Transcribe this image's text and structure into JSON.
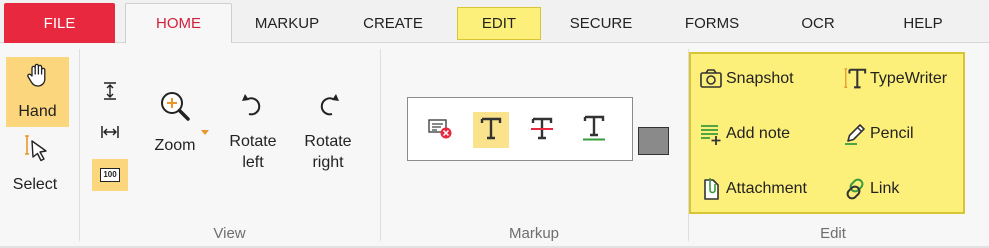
{
  "tabs": {
    "file": "FILE",
    "home": "HOME",
    "markup": "MARKUP",
    "create": "CREATE",
    "edit": "EDIT",
    "secure": "SECURE",
    "forms": "FORMS",
    "ocr": "OCR",
    "help": "HELP"
  },
  "view_group": {
    "hand_label": "Hand",
    "select_label": "Select",
    "fit_width_icon": "fit-width-icon",
    "fit_height_icon": "fit-height-icon",
    "actual_size_icon_text": "100",
    "zoom_label": "Zoom",
    "rotate_left_label": "Rotate left",
    "rotate_right_label": "Rotate right",
    "group_label": "View"
  },
  "markup_group": {
    "tools": [
      "note-delete-icon",
      "highlight-text-icon",
      "strikeout-text-icon",
      "underline-text-icon"
    ],
    "group_label": "Markup",
    "color_swatch": "#8a8a8a"
  },
  "edit_group": {
    "snapshot": "Snapshot",
    "typewriter": "TypeWriter",
    "add_note": "Add note",
    "pencil": "Pencil",
    "attachment": "Attachment",
    "link": "Link",
    "group_label": "Edit"
  },
  "colors": {
    "file_tab": "#e8283f",
    "home_tab_text": "#d21f3c",
    "highlight_yellow": "#fdf07a",
    "active_tool": "#fbd67c"
  }
}
